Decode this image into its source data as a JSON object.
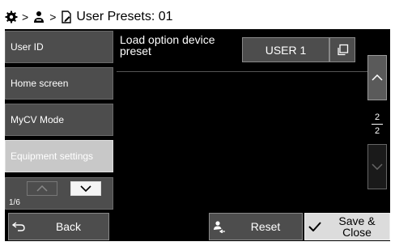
{
  "header": {
    "title": "User Presets: 01",
    "separator": ">"
  },
  "nav": {
    "items": [
      {
        "label": "User ID"
      },
      {
        "label": "Home screen"
      },
      {
        "label": "MyCV Mode"
      },
      {
        "label": "Equipment settings"
      }
    ],
    "page": "1/6"
  },
  "main": {
    "setting_label": "Load option device preset",
    "setting_value": "USER 1"
  },
  "scroll": {
    "current_page": "2",
    "total_pages": "2"
  },
  "footer": {
    "back_label": "Back",
    "reset_label": "Reset",
    "save_close_label": "Save & Close"
  },
  "colors": {
    "background": "#000000",
    "button": "#4d4d4d",
    "active": "#c8c8c8"
  }
}
